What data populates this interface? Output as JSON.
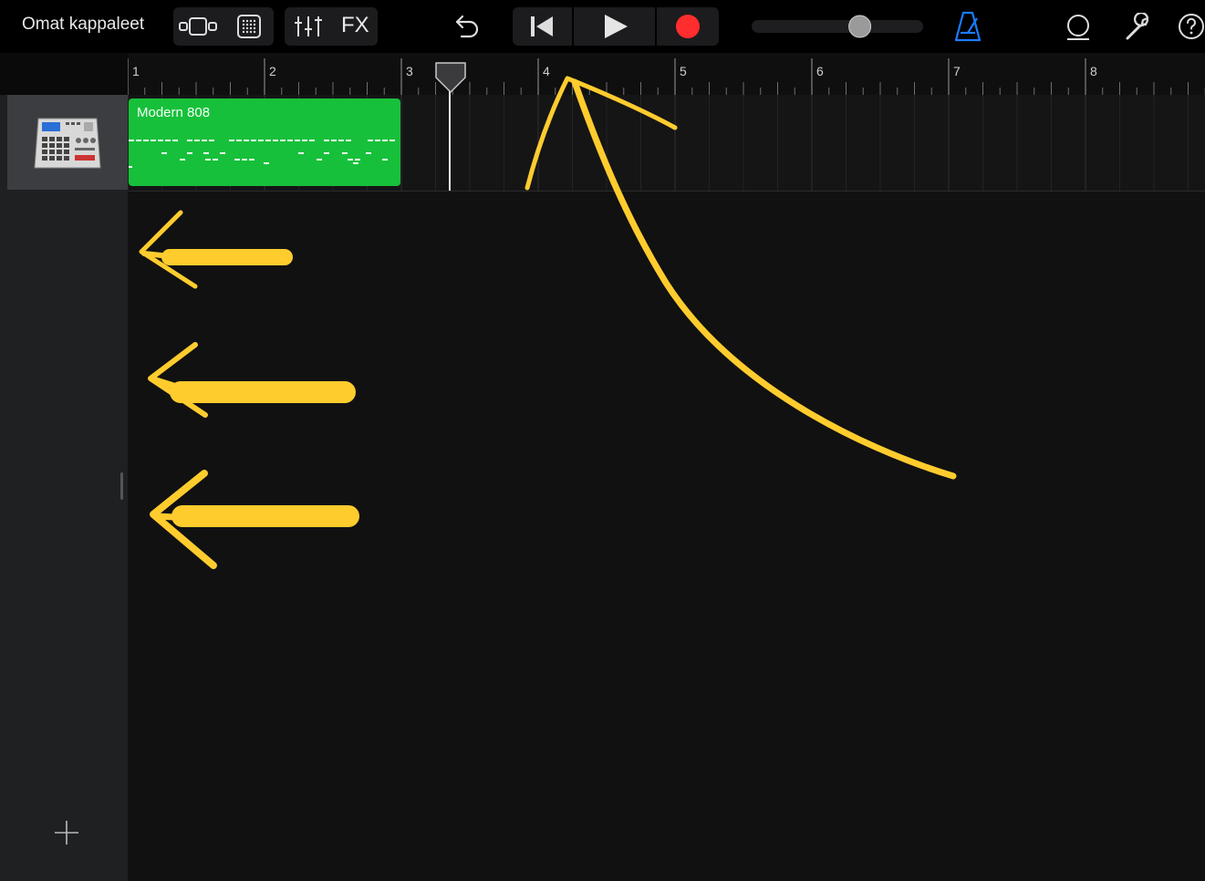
{
  "toolbar": {
    "my_songs_label": "Omat kappaleet",
    "fx_label": "FX",
    "tempo_slider_level": 0.65,
    "colors": {
      "record": "#ff2d2d",
      "metronome": "#1a7cff"
    },
    "icons": [
      "view-toggle-icon",
      "tracks-grid-icon",
      "mixer-icon",
      "undo-icon",
      "go-to-beginning-icon",
      "play-icon",
      "record-icon",
      "metronome-icon",
      "loop-browser-icon",
      "settings-wrench-icon",
      "help-icon"
    ]
  },
  "ruler": {
    "bars": [
      "1",
      "2",
      "3",
      "4",
      "5",
      "6",
      "7",
      "8"
    ]
  },
  "track": {
    "region_name": "Modern 808",
    "region_color": "#17c03a",
    "instrument_icon": "drum-machine-icon"
  },
  "annotations": {
    "color": "#ffcc2e",
    "shapes": [
      "arrow-left-1",
      "arrow-left-2",
      "arrow-left-3",
      "curved-arrow-up"
    ]
  }
}
